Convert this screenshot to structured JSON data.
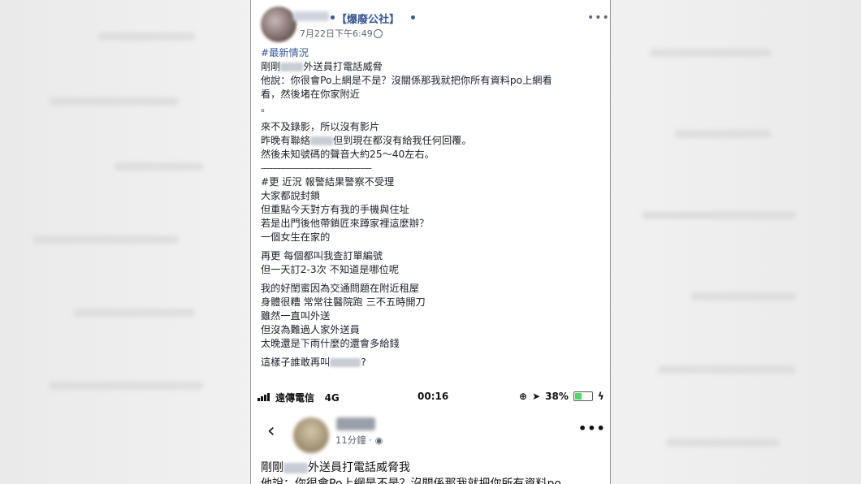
{
  "post": {
    "page_name": "【爆廢公社】",
    "date": "7月22日下午6:49",
    "menu_icon": "more-dots-icon",
    "privacy_icon": "globe-icon",
    "lines": [
      "#最新情況",
      "剛剛",
      "外送員打電話威脅",
      "他說：你很會Po上網是不是？沒關係那我就把你所有資料po上網看",
      "看，然後堵在你家附近",
      "。",
      "來不及錄影，所以沒有影片",
      "昨晚有聯絡",
      "但到現在都沒有給我任何回覆。",
      "然後未知號碼的聲音大約25～40左右。",
      "----------------------------------------",
      "#更 近況 報警結果警察不受理",
      "大家都說封鎖",
      "但重點今天對方有我的手機與住址",
      "若是出門後他帶鎖匠來蹲家裡這麼辦？",
      "一個女生在家的",
      "再更 每個都叫我查訂單編號",
      "但一天訂2-3次 不知道是哪位呢",
      "我的好閨蜜因為交通問題在附近租屋",
      "身體很糟 常常往醫院跑 三不五時開刀",
      "雖然一直叫外送",
      "但沒為難過人家外送員",
      "太晚還是下雨什麼的還會多給錢",
      "這樣子誰敢再叫",
      "?"
    ]
  },
  "phone": {
    "carrier": "遠傳電信",
    "network": "4G",
    "time": "00:16",
    "battery": "38%",
    "battery_level": 0.38
  },
  "screenshot_post": {
    "time": "11分鐘",
    "text_line1_a": "剛剛",
    "text_line1_b": "外送員打電話威脅我",
    "text_line2": "他說：你很會Po上網是不是？沒關係那我就把你所有資料po"
  }
}
